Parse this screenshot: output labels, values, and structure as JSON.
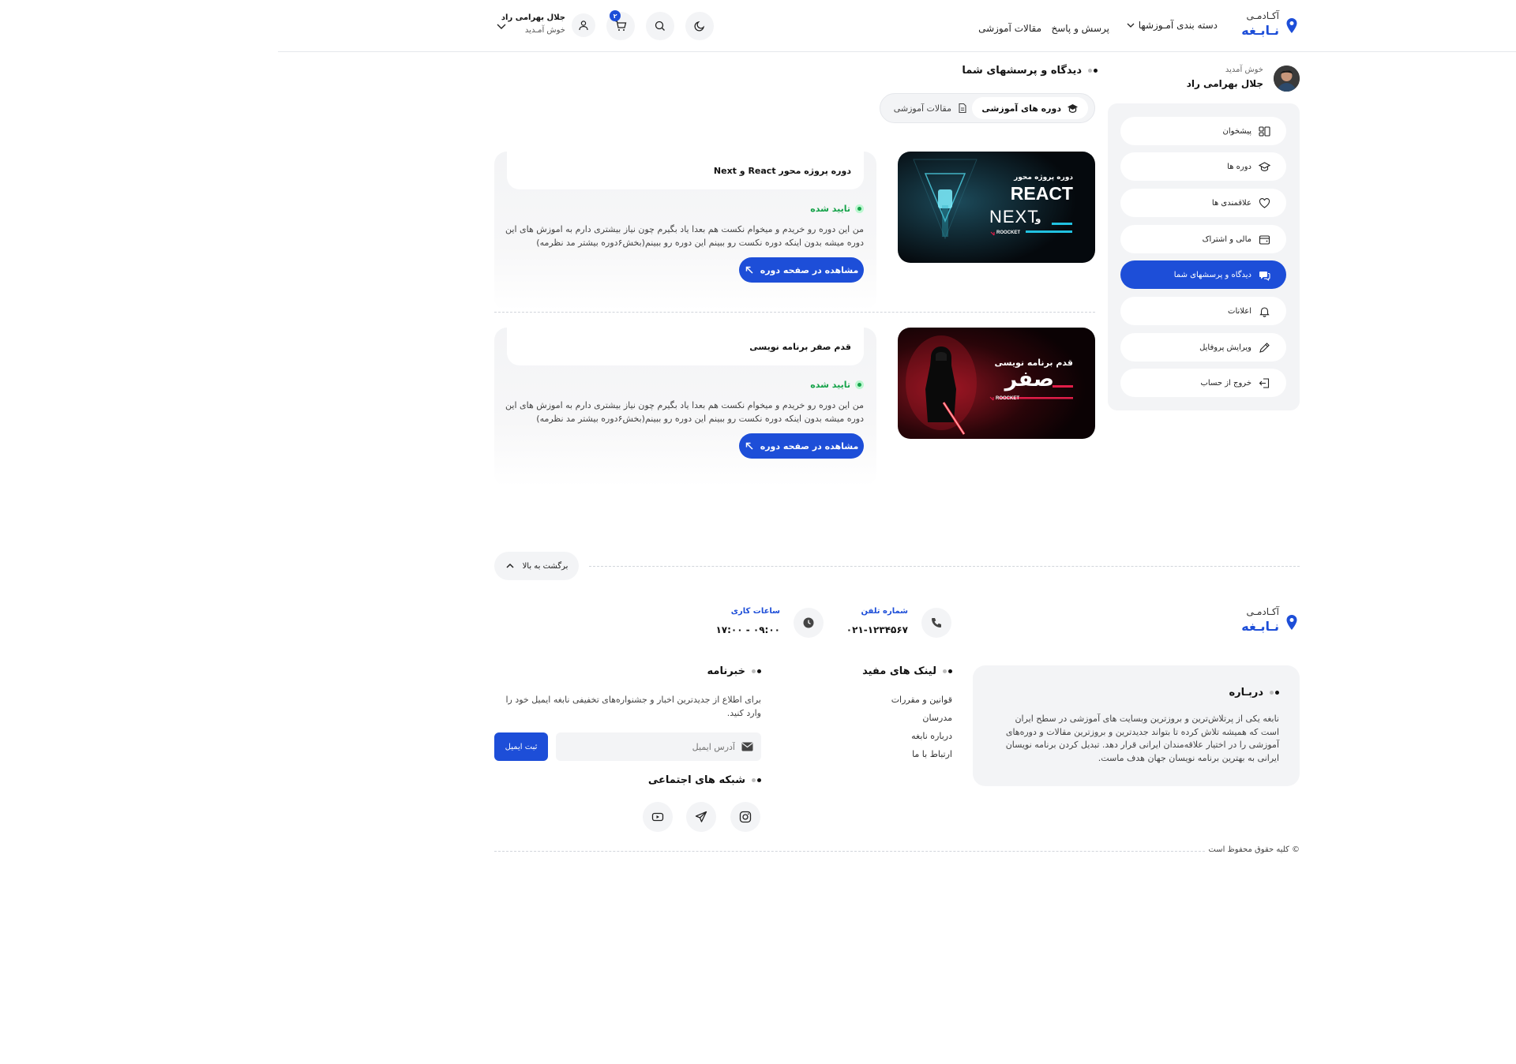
{
  "header": {
    "logo_top": "آکـادمـی",
    "logo_bottom": "نـابـغه",
    "nav": [
      "دسته بندی آمـوزشها",
      "پرسش و پاسخ",
      "مقالات آموزشی"
    ],
    "cart_count": "۲",
    "user_name": "جلال بهرامی راد",
    "user_greeting": "خوش آمـدید"
  },
  "sidebar": {
    "greeting": "خوش آمدید",
    "user_name": "جلال بهرامی راد",
    "items": [
      {
        "label": "پیشخوان",
        "icon": "dashboard-icon"
      },
      {
        "label": "دوره ها",
        "icon": "graduation-cap-icon"
      },
      {
        "label": "علاقمندی ها",
        "icon": "heart-icon"
      },
      {
        "label": "مالی و اشتراک",
        "icon": "wallet-icon"
      },
      {
        "label": "دیدگاه و پرسشهای شما",
        "icon": "comments-icon",
        "active": true
      },
      {
        "label": "اعلانات",
        "icon": "bell-icon"
      },
      {
        "label": "ویرایش پروفایل",
        "icon": "pencil-icon"
      },
      {
        "label": "خروج از حساب",
        "icon": "logout-icon"
      }
    ]
  },
  "main": {
    "title": "دیدگاه و پرسشهای شما",
    "tabs": [
      {
        "label": "دوره های آموزشی",
        "active": true
      },
      {
        "label": "مقالات آموزشی",
        "active": false
      }
    ],
    "comments": [
      {
        "course_title": "دوره پروژه محور React و Next",
        "thumb_line1": "دوره پروژه محور",
        "thumb_line2": "REACT",
        "thumb_line3": "NEXT",
        "thumb_and": "و",
        "thumb_brand": "ROOCKET",
        "status": "تایید شده",
        "text": "من این دوره رو خریدم و میخوام نکست هم بعدا یاد بگیرم چون نیاز بیشتری دارم به اموزش های این دوره میشه بدون اینکه دوره نکست رو ببینم این دوره رو ببینم(بخش۶دوره بیشتر مد نظرمه)",
        "button": "مشاهده در صفحه دوره"
      },
      {
        "course_title": "قدم صفر برنامه نویسی",
        "thumb_line1": "قدم  برنامه نویسی",
        "thumb_line2": "صفر",
        "thumb_brand": "ROOCKET",
        "status": "تایید شده",
        "text": "من این دوره رو خریدم و میخوام نکست هم بعدا یاد بگیرم چون نیاز بیشتری دارم به اموزش های این دوره میشه بدون اینکه دوره نکست رو ببینم این دوره رو ببینم(بخش۶دوره بیشتر مد نظرمه)",
        "button": "مشاهده در صفحه دوره"
      }
    ]
  },
  "footer": {
    "back_to_top": "برگشت به بالا",
    "logo_top": "آکـادمـی",
    "logo_bottom": "نـابـغه",
    "phone_label": "شماره تلفن",
    "phone_value": "۰۲۱-۱۲۳۴۵۶۷",
    "hours_label": "ساعات کاری",
    "hours_value": "۰۹:۰۰ - ۱۷:۰۰",
    "about_title": "دربـاره",
    "about_text": "نابغه یکی از پرتلاش‌ترین و بروزترین وبسایت های آموزشی در سطح ایران است که همیشه تلاش کرده تا بتواند جدیدترین و بروزترین مقالات و دوره‌های آموزشی را در اختیار علاقه‌مندان ایرانی قرار دهد. تبدیل کردن برنامه نویسان ایرانی به بهترین برنامه نویسان جهان هدف ماست.",
    "links_title": "لینک های مفید",
    "links": [
      "قوانین و مقررات",
      "مدرسان",
      "درباره نابغه",
      "ارتباط با ما"
    ],
    "newsletter_title": "خبرنامه",
    "newsletter_text": "برای اطلاع از جدیدترین اخبار و جشنواره‌های تخفیفی نابغه ایمیل خود را وارد کنید.",
    "email_placeholder": "آدرس ایمیل",
    "subscribe_button": "ثبت ایمیل",
    "social_title": "شبکه های اجتماعی",
    "copyright": "© کلیه حقوق محفوظ است"
  },
  "colors": {
    "accent": "#1d4ed8",
    "success": "#16a34a",
    "panel": "#f3f4f6"
  }
}
